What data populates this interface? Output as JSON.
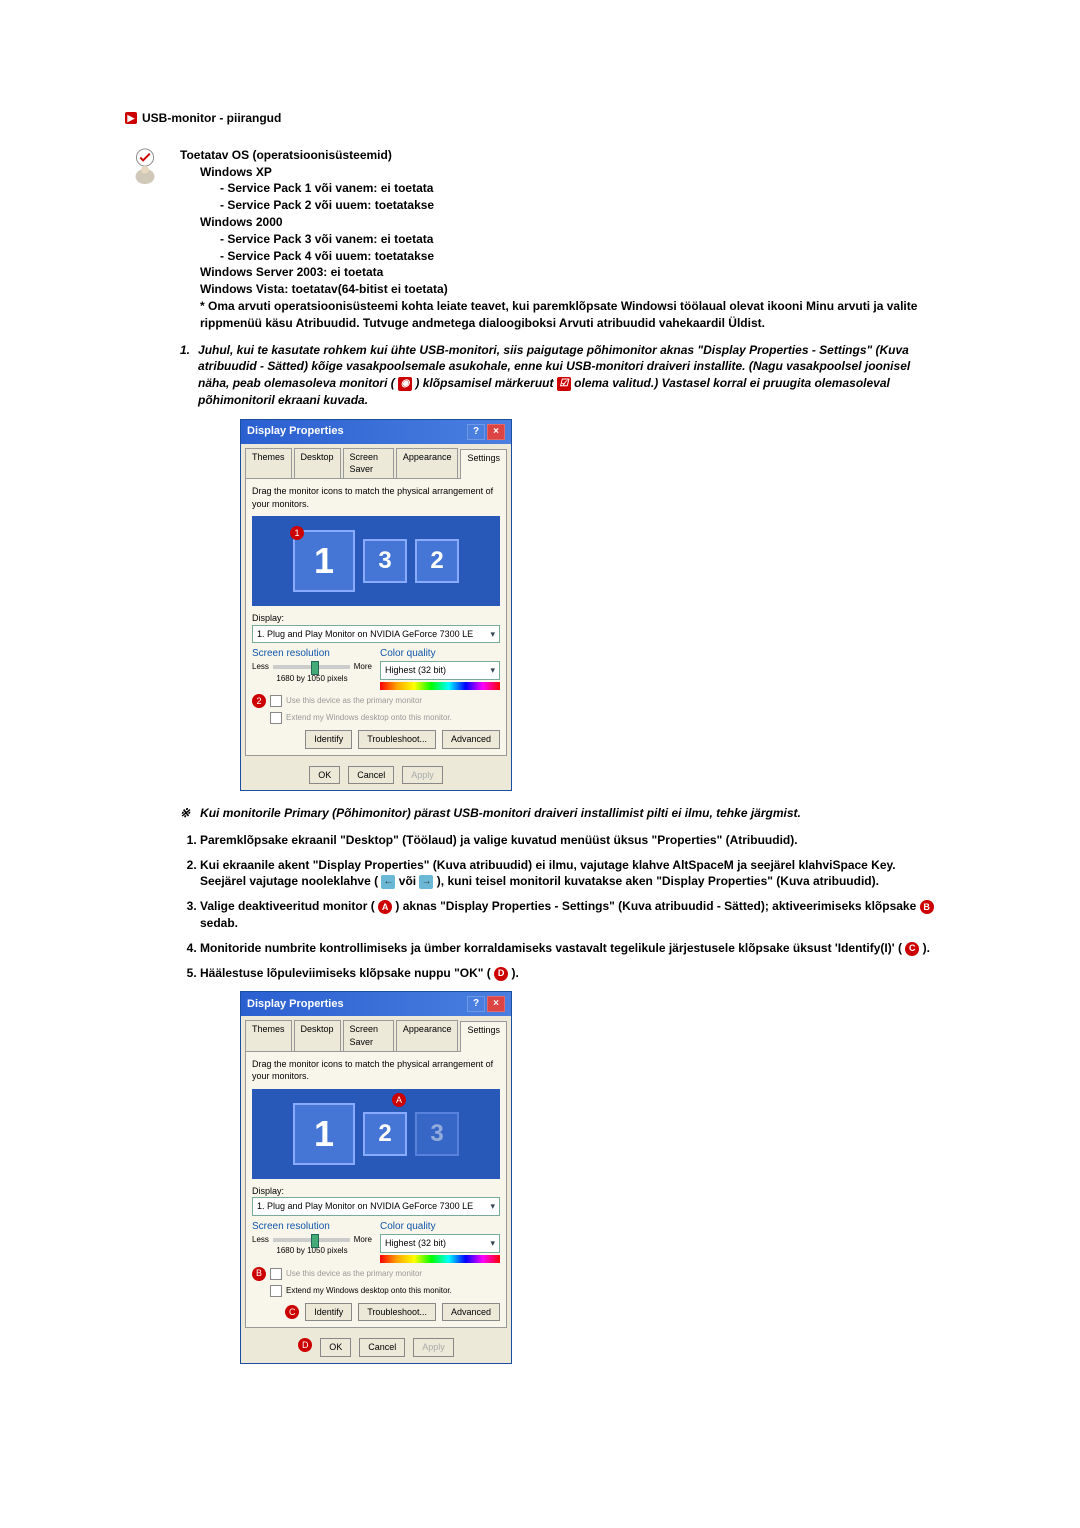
{
  "title": {
    "icon": "▶",
    "text": "USB-monitor - piirangud"
  },
  "os_section": {
    "heading": "Toetatav OS (operatsioonisüsteemid)",
    "xp": "Windows XP",
    "xp_sp1": "- Service Pack 1 või vanem: ei toetata",
    "xp_sp2": "- Service Pack 2 või uuem: toetatakse",
    "w2000": "Windows 2000",
    "w2000_sp3": "- Service Pack 3 või vanem: ei toetata",
    "w2000_sp4": "- Service Pack 4 või uuem: toetatakse",
    "server2003": "Windows Server 2003: ei toetata",
    "vista": "Windows Vista: toetatav(64-bitist ei toetata)",
    "note": "* Oma arvuti operatsioonisüsteemi kohta leiate teavet, kui paremklõpsate Windowsi töölaual olevat ikooni Minu arvuti ja valite rippmenüü käsu Atribuudid. Tutvuge andmetega dialoogiboksi Arvuti atribuudid vahekaardil Üldist."
  },
  "note1": {
    "num": "1.",
    "text_a": "Juhul, kui te kasutate rohkem kui ühte USB-monitori, siis paigutage põhimonitor aknas \"Display Properties - Settings\" (Kuva atribuudid - Sätted) kõige vasakpoolsemale asukohale, enne kui USB-monitori draiveri installite. (Nagu vasakpoolsel joonisel näha, peab olemasoleva monitori (",
    "text_b": ") klõpsamisel märkeruut",
    "text_c": " olema valitud.) Vastasel korral ei pruugita olemasoleval põhimonitoril ekraani kuvada."
  },
  "dialog": {
    "title": "Display Properties",
    "help": "?",
    "close": "×",
    "tabs": [
      "Themes",
      "Desktop",
      "Screen Saver",
      "Appearance",
      "Settings"
    ],
    "hint": "Drag the monitor icons to match the physical arrangement of your monitors.",
    "display_label": "Display:",
    "display_value": "1. Plug and Play Monitor on NVIDIA GeForce 7300 LE",
    "screen_res_label": "Screen resolution",
    "less": "Less",
    "more": "More",
    "res": "1680 by 1050 pixels",
    "color_label": "Color quality",
    "color_value": "Highest (32 bit)",
    "chk1": "Use this device as the primary monitor",
    "chk2": "Extend my Windows desktop onto this monitor.",
    "identify": "Identify",
    "troubleshoot": "Troubleshoot...",
    "advanced": "Advanced",
    "ok": "OK",
    "cancel": "Cancel",
    "apply": "Apply"
  },
  "star_note": {
    "star": "※",
    "text": "Kui monitorile Primary (Põhimonitor) pärast USB-monitori draiveri installimist pilti ei ilmu, tehke järgmist."
  },
  "steps": {
    "s1": "Paremklõpsake ekraanil \"Desktop\" (Töölaud) ja valige kuvatud menüüst üksus \"Properties\" (Atribuudid).",
    "s2_a": "Kui ekraanile akent \"Display Properties\" (Kuva atribuudid) ei ilmu, vajutage klahve AltSpaceM ja seejärel klahviSpace Key. Seejärel vajutage nooleklahve (",
    "s2_b": " või ",
    "s2_c": "), kuni teisel monitoril kuvatakse aken \"Display Properties\" (Kuva atribuudid).",
    "s3_a": "Valige deaktiveeritud monitor (",
    "s3_b": ") aknas \"Display Properties - Settings\" (Kuva atribuudid - Sätted); aktiveerimiseks klõpsake ",
    "s3_c": " sedab.",
    "s4_a": "Monitoride numbrite kontrollimiseks ja ümber korraldamiseks vastavalt tegelikule järjestusele klõpsake üksust 'Identify(I)' (",
    "s4_b": ").",
    "s5_a": "Häälestuse lõpuleviimiseks klõpsake nuppu \"OK\" (",
    "s5_b": ")."
  },
  "mon_nums": {
    "m1": "1",
    "m2": "2",
    "m3": "3"
  }
}
